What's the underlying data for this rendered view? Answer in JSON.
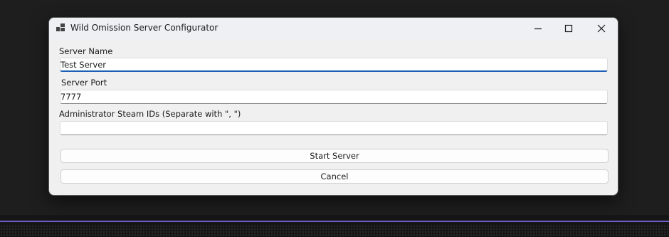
{
  "window": {
    "title": "Wild Omission Server Configurator",
    "app_icon": "app-icon",
    "caption_buttons": [
      "minimize-icon",
      "maximize-icon",
      "close-icon"
    ]
  },
  "form": {
    "server_name": {
      "label": "Server Name",
      "value": "Test Server"
    },
    "server_port": {
      "label": "Server Port",
      "value": "7777"
    },
    "admin_ids": {
      "label": "Administrator Steam IDs (Separate with \", \")",
      "value": ""
    }
  },
  "actions": {
    "start_label": "Start Server",
    "cancel_label": "Cancel"
  },
  "colors": {
    "focus_accent": "#1a5fb4",
    "taskbar_accent": "#6f5fc9"
  }
}
